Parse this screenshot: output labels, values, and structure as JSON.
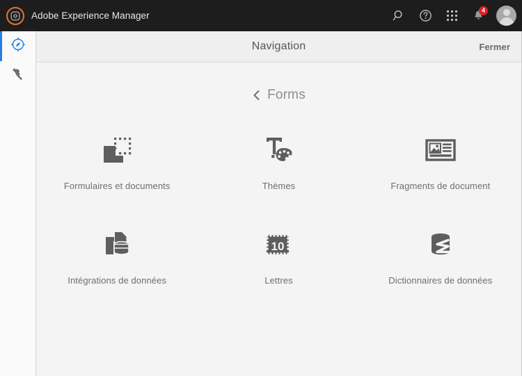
{
  "topbar": {
    "logo_icon": "aem-logo-icon",
    "title": "Adobe Experience Manager",
    "accent_color": "#e8742c",
    "background": "#1d1d1d",
    "actions": [
      {
        "name": "search-icon",
        "label": "Rechercher"
      },
      {
        "name": "help-icon",
        "label": "Aide"
      },
      {
        "name": "solutions-grid-icon",
        "label": "Solutions"
      },
      {
        "name": "notifications-bell-icon",
        "label": "Notifications",
        "badge": "4",
        "badge_color": "#e02020"
      }
    ],
    "avatar": {
      "name": "user-avatar",
      "label": "Utilisateur"
    }
  },
  "rail": {
    "items": [
      {
        "name": "navigation",
        "icon": "compass-icon",
        "label": "Navigation",
        "active": true,
        "color": "#2680eb"
      },
      {
        "name": "tools",
        "icon": "hammer-icon",
        "label": "Outils",
        "active": false,
        "color": "#6e6e6e"
      }
    ]
  },
  "panel": {
    "title": "Navigation",
    "close_label": "Fermer",
    "breadcrumb": {
      "back_icon": "chevron-left-icon",
      "label": "Forms"
    },
    "tiles": [
      {
        "id": "formulaires-et-documents",
        "label": "Formulaires et documents",
        "icon": "forms-and-documents-icon"
      },
      {
        "id": "themes",
        "label": "Thèmes",
        "icon": "themes-palette-icon"
      },
      {
        "id": "fragments-de-document",
        "label": "Fragments de document",
        "icon": "document-fragment-icon"
      },
      {
        "id": "integrations-de-donnees",
        "label": "Intégrations de données",
        "icon": "data-integrations-icon"
      },
      {
        "id": "lettres",
        "label": "Lettres",
        "icon": "letters-stamp-icon"
      },
      {
        "id": "dictionnaires-de-donnees",
        "label": "Dictionnaires de données",
        "icon": "data-dictionaries-icon"
      }
    ]
  }
}
